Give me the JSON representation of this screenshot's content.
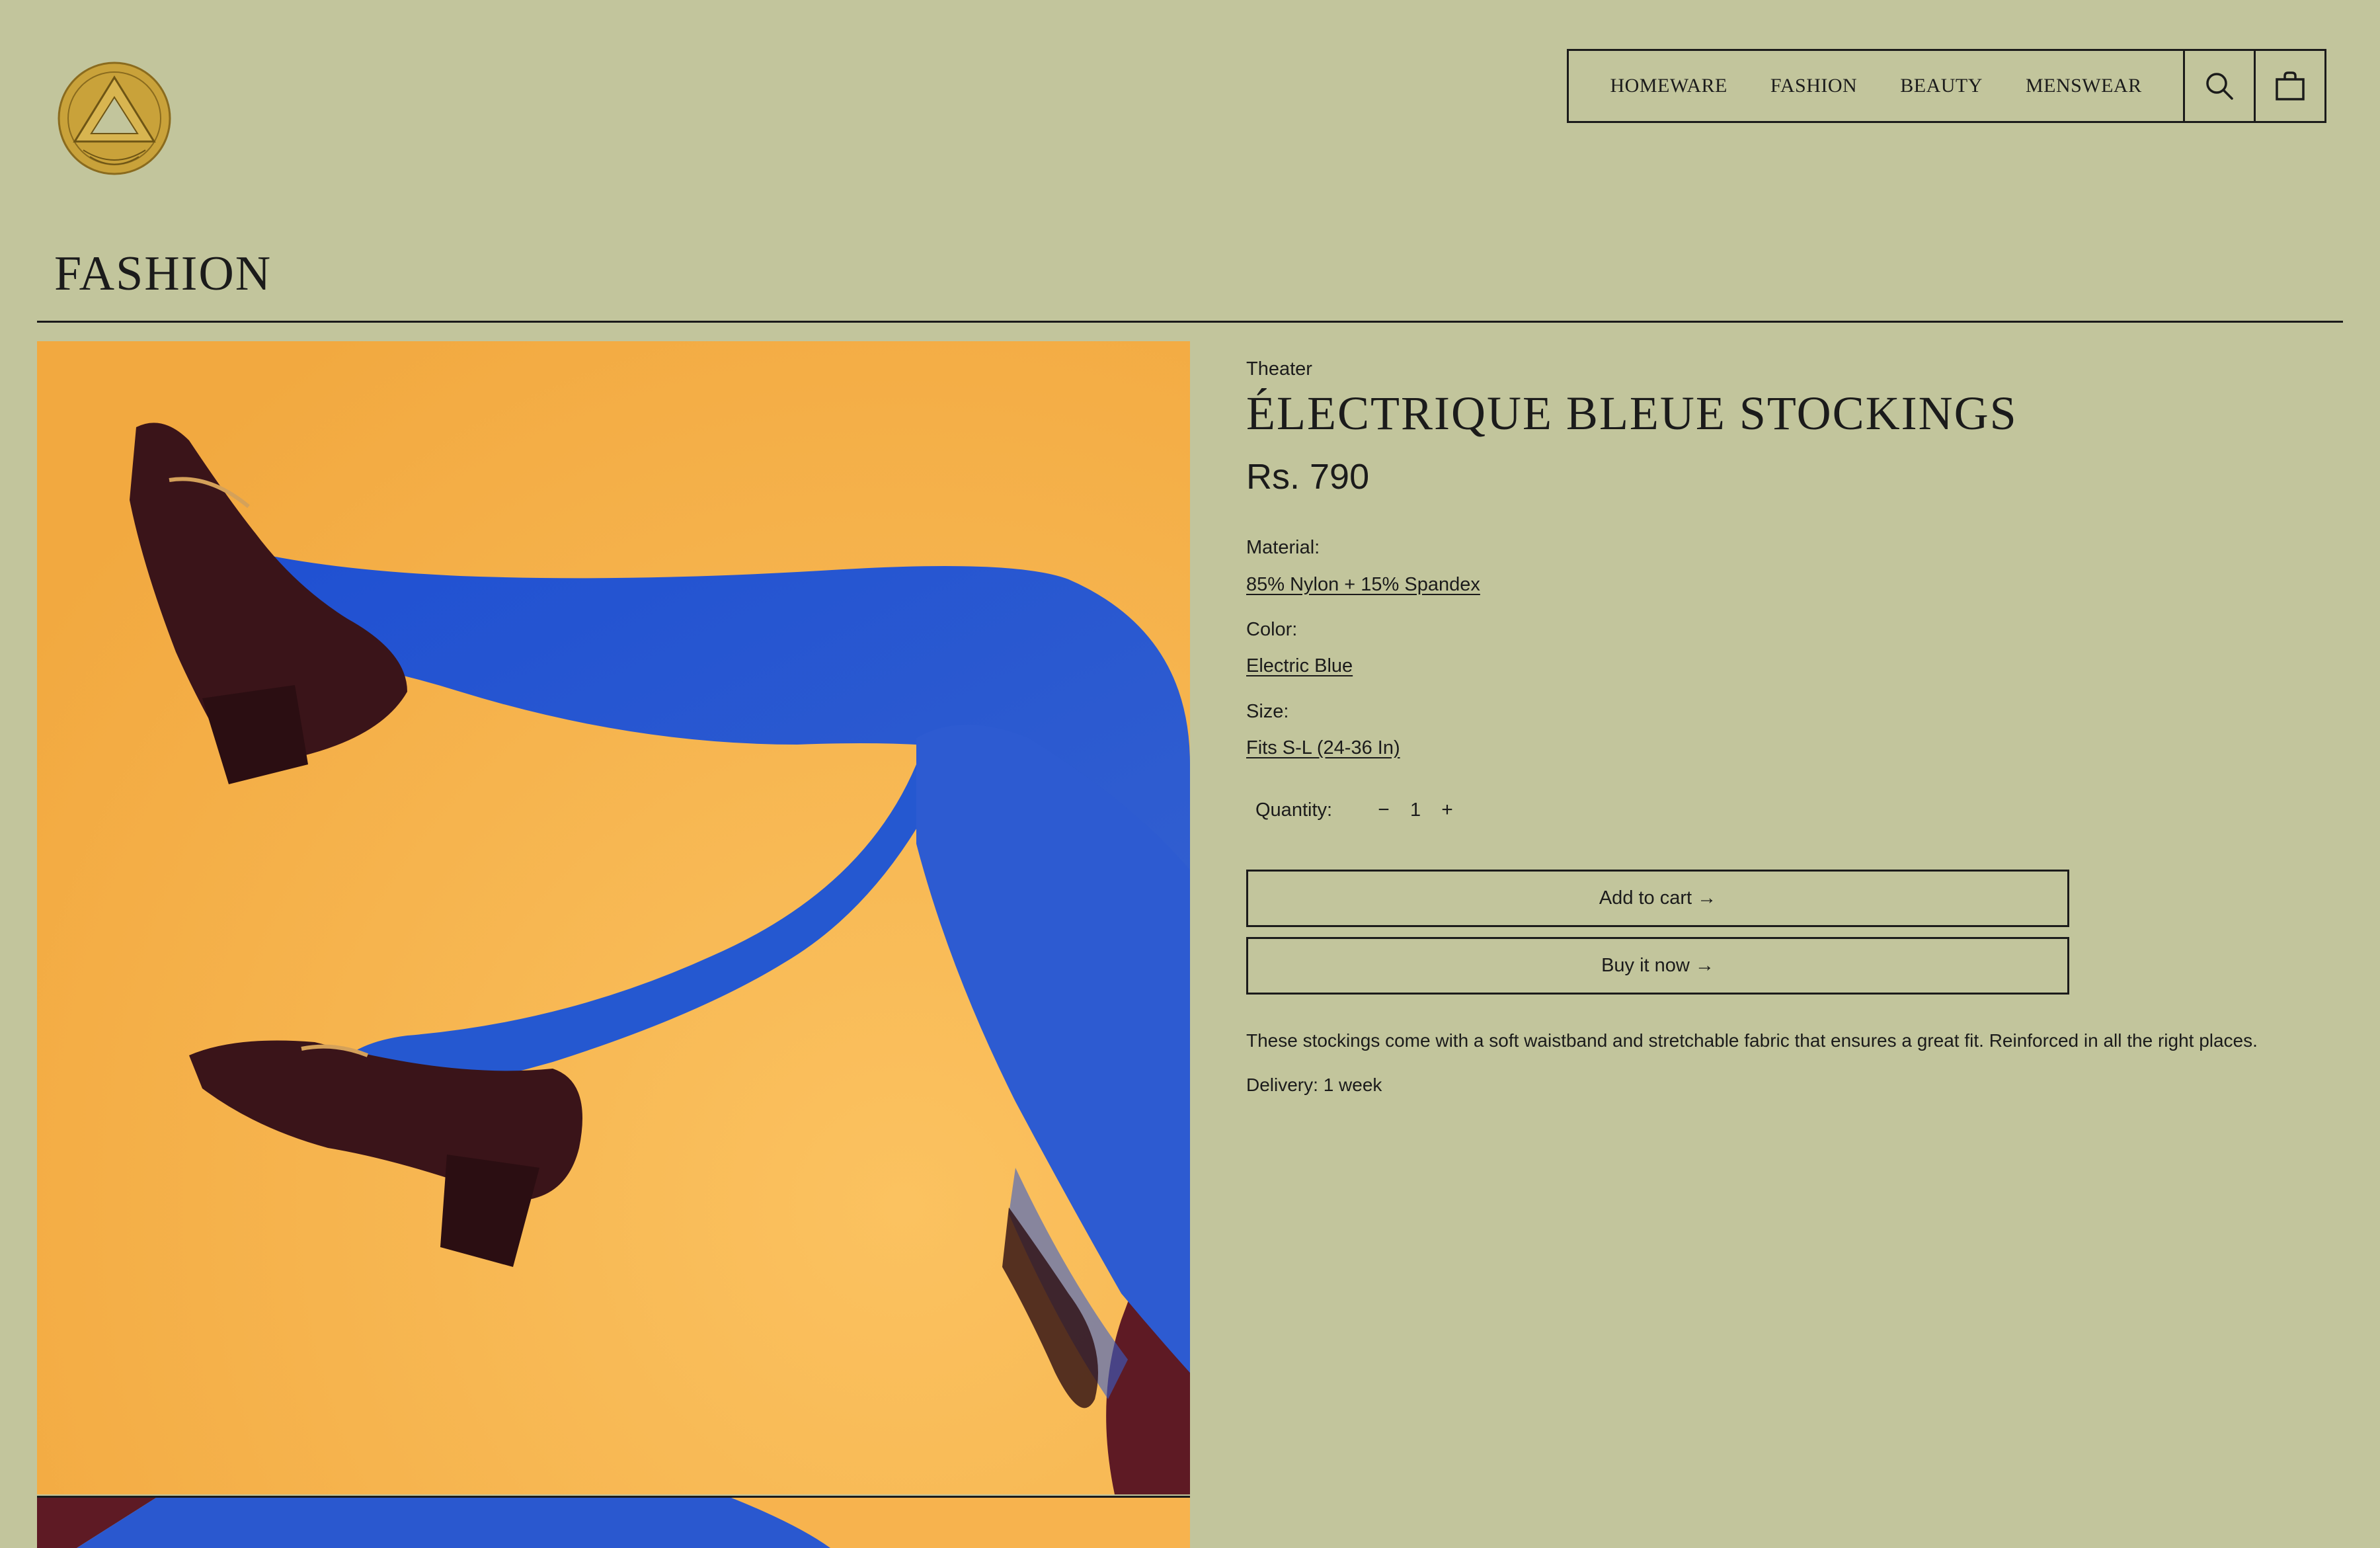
{
  "store": {
    "logo_icon": "triangle-circle-logo-icon"
  },
  "nav": {
    "links": [
      "HOMEWARE",
      "FASHION",
      "BEAUTY",
      "MENSWEAR"
    ],
    "search_icon": "search-icon",
    "cart_icon": "bag-icon"
  },
  "page": {
    "title": "FASHION"
  },
  "product": {
    "vendor": "Theater",
    "title": "ÉLECTRIQUE BLEUE STOCKINGS",
    "price": "Rs. 790",
    "options": [
      {
        "label": "Material:",
        "value": "85% Nylon + 15% Spandex"
      },
      {
        "label": "Color:",
        "value": "Electric Blue"
      },
      {
        "label": "Size:",
        "value": "Fits S-L (24-36 In)"
      }
    ],
    "quantity_label": "Quantity:",
    "quantity_minus": "−",
    "quantity": "1",
    "quantity_plus": "+",
    "add_to_cart": "Add to cart →",
    "buy_now": "Buy it now →",
    "description": "These stockings come with a soft waistband and stretchable fabric that ensures a great fit. Reinforced in all the right places.",
    "delivery": "Delivery: 1 week"
  },
  "colors": {
    "background": "#c2c59c",
    "photo_background": "#f7b34e",
    "stocking_blue": "#2a58cf",
    "shoe_burgundy": "#3a1419",
    "logo_gold": "#c9a23a"
  }
}
